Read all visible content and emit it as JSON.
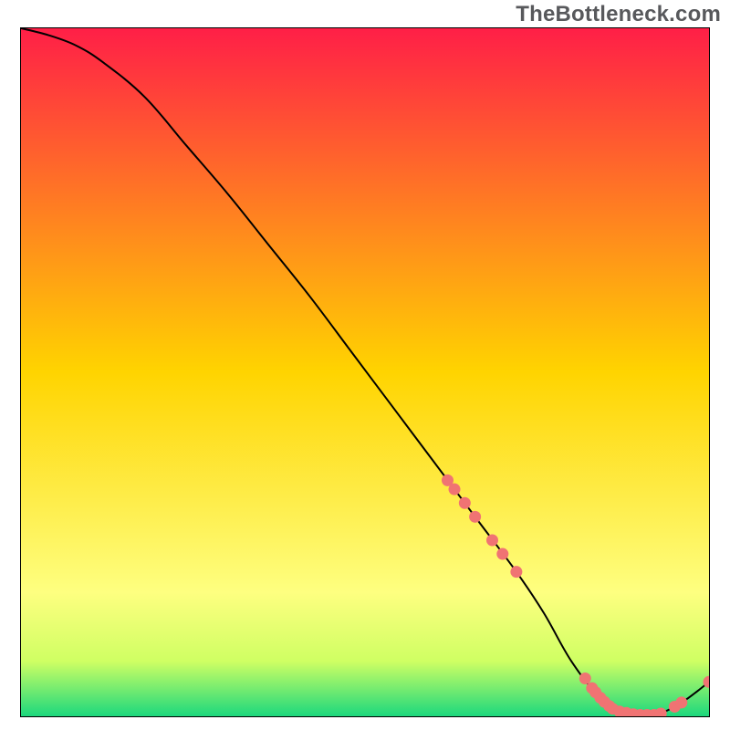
{
  "watermark": "TheBottleneck.com",
  "colors": {
    "top": "#ff1f47",
    "mid": "#ffd400",
    "lower1": "#feff80",
    "lower2": "#cfff63",
    "bottom": "#1cd87d",
    "marker": "#f07373",
    "line": "#000000",
    "border": "#000000"
  },
  "chart_data": {
    "type": "line",
    "title": "",
    "xlabel": "",
    "ylabel": "",
    "xlim": [
      0,
      100
    ],
    "ylim": [
      0,
      100
    ],
    "x": [
      0,
      4,
      8,
      12,
      18,
      24,
      30,
      36,
      42,
      48,
      54,
      60,
      66,
      72,
      76,
      80,
      84,
      88,
      92,
      96,
      100
    ],
    "values": [
      100,
      99,
      97.5,
      95,
      90,
      83,
      76,
      68.5,
      61,
      53,
      45,
      37,
      29,
      21,
      15,
      8,
      3,
      0.5,
      0.2,
      2,
      5
    ],
    "markers": [
      {
        "x": 62,
        "y": 34.3
      },
      {
        "x": 63,
        "y": 33.0
      },
      {
        "x": 64.5,
        "y": 31.0
      },
      {
        "x": 66,
        "y": 29.0
      },
      {
        "x": 68.5,
        "y": 25.6
      },
      {
        "x": 70,
        "y": 23.6
      },
      {
        "x": 72,
        "y": 21.0
      },
      {
        "x": 82,
        "y": 5.5
      },
      {
        "x": 83,
        "y": 4.1
      },
      {
        "x": 83.5,
        "y": 3.5
      },
      {
        "x": 84.2,
        "y": 2.7
      },
      {
        "x": 84.8,
        "y": 2.1
      },
      {
        "x": 85.5,
        "y": 1.5
      },
      {
        "x": 86,
        "y": 1.1
      },
      {
        "x": 87,
        "y": 0.7
      },
      {
        "x": 88,
        "y": 0.5
      },
      {
        "x": 89,
        "y": 0.3
      },
      {
        "x": 90,
        "y": 0.2
      },
      {
        "x": 91,
        "y": 0.2
      },
      {
        "x": 92,
        "y": 0.2
      },
      {
        "x": 93,
        "y": 0.4
      },
      {
        "x": 95,
        "y": 1.4
      },
      {
        "x": 96,
        "y": 2.0
      },
      {
        "x": 100,
        "y": 5.0
      }
    ]
  }
}
